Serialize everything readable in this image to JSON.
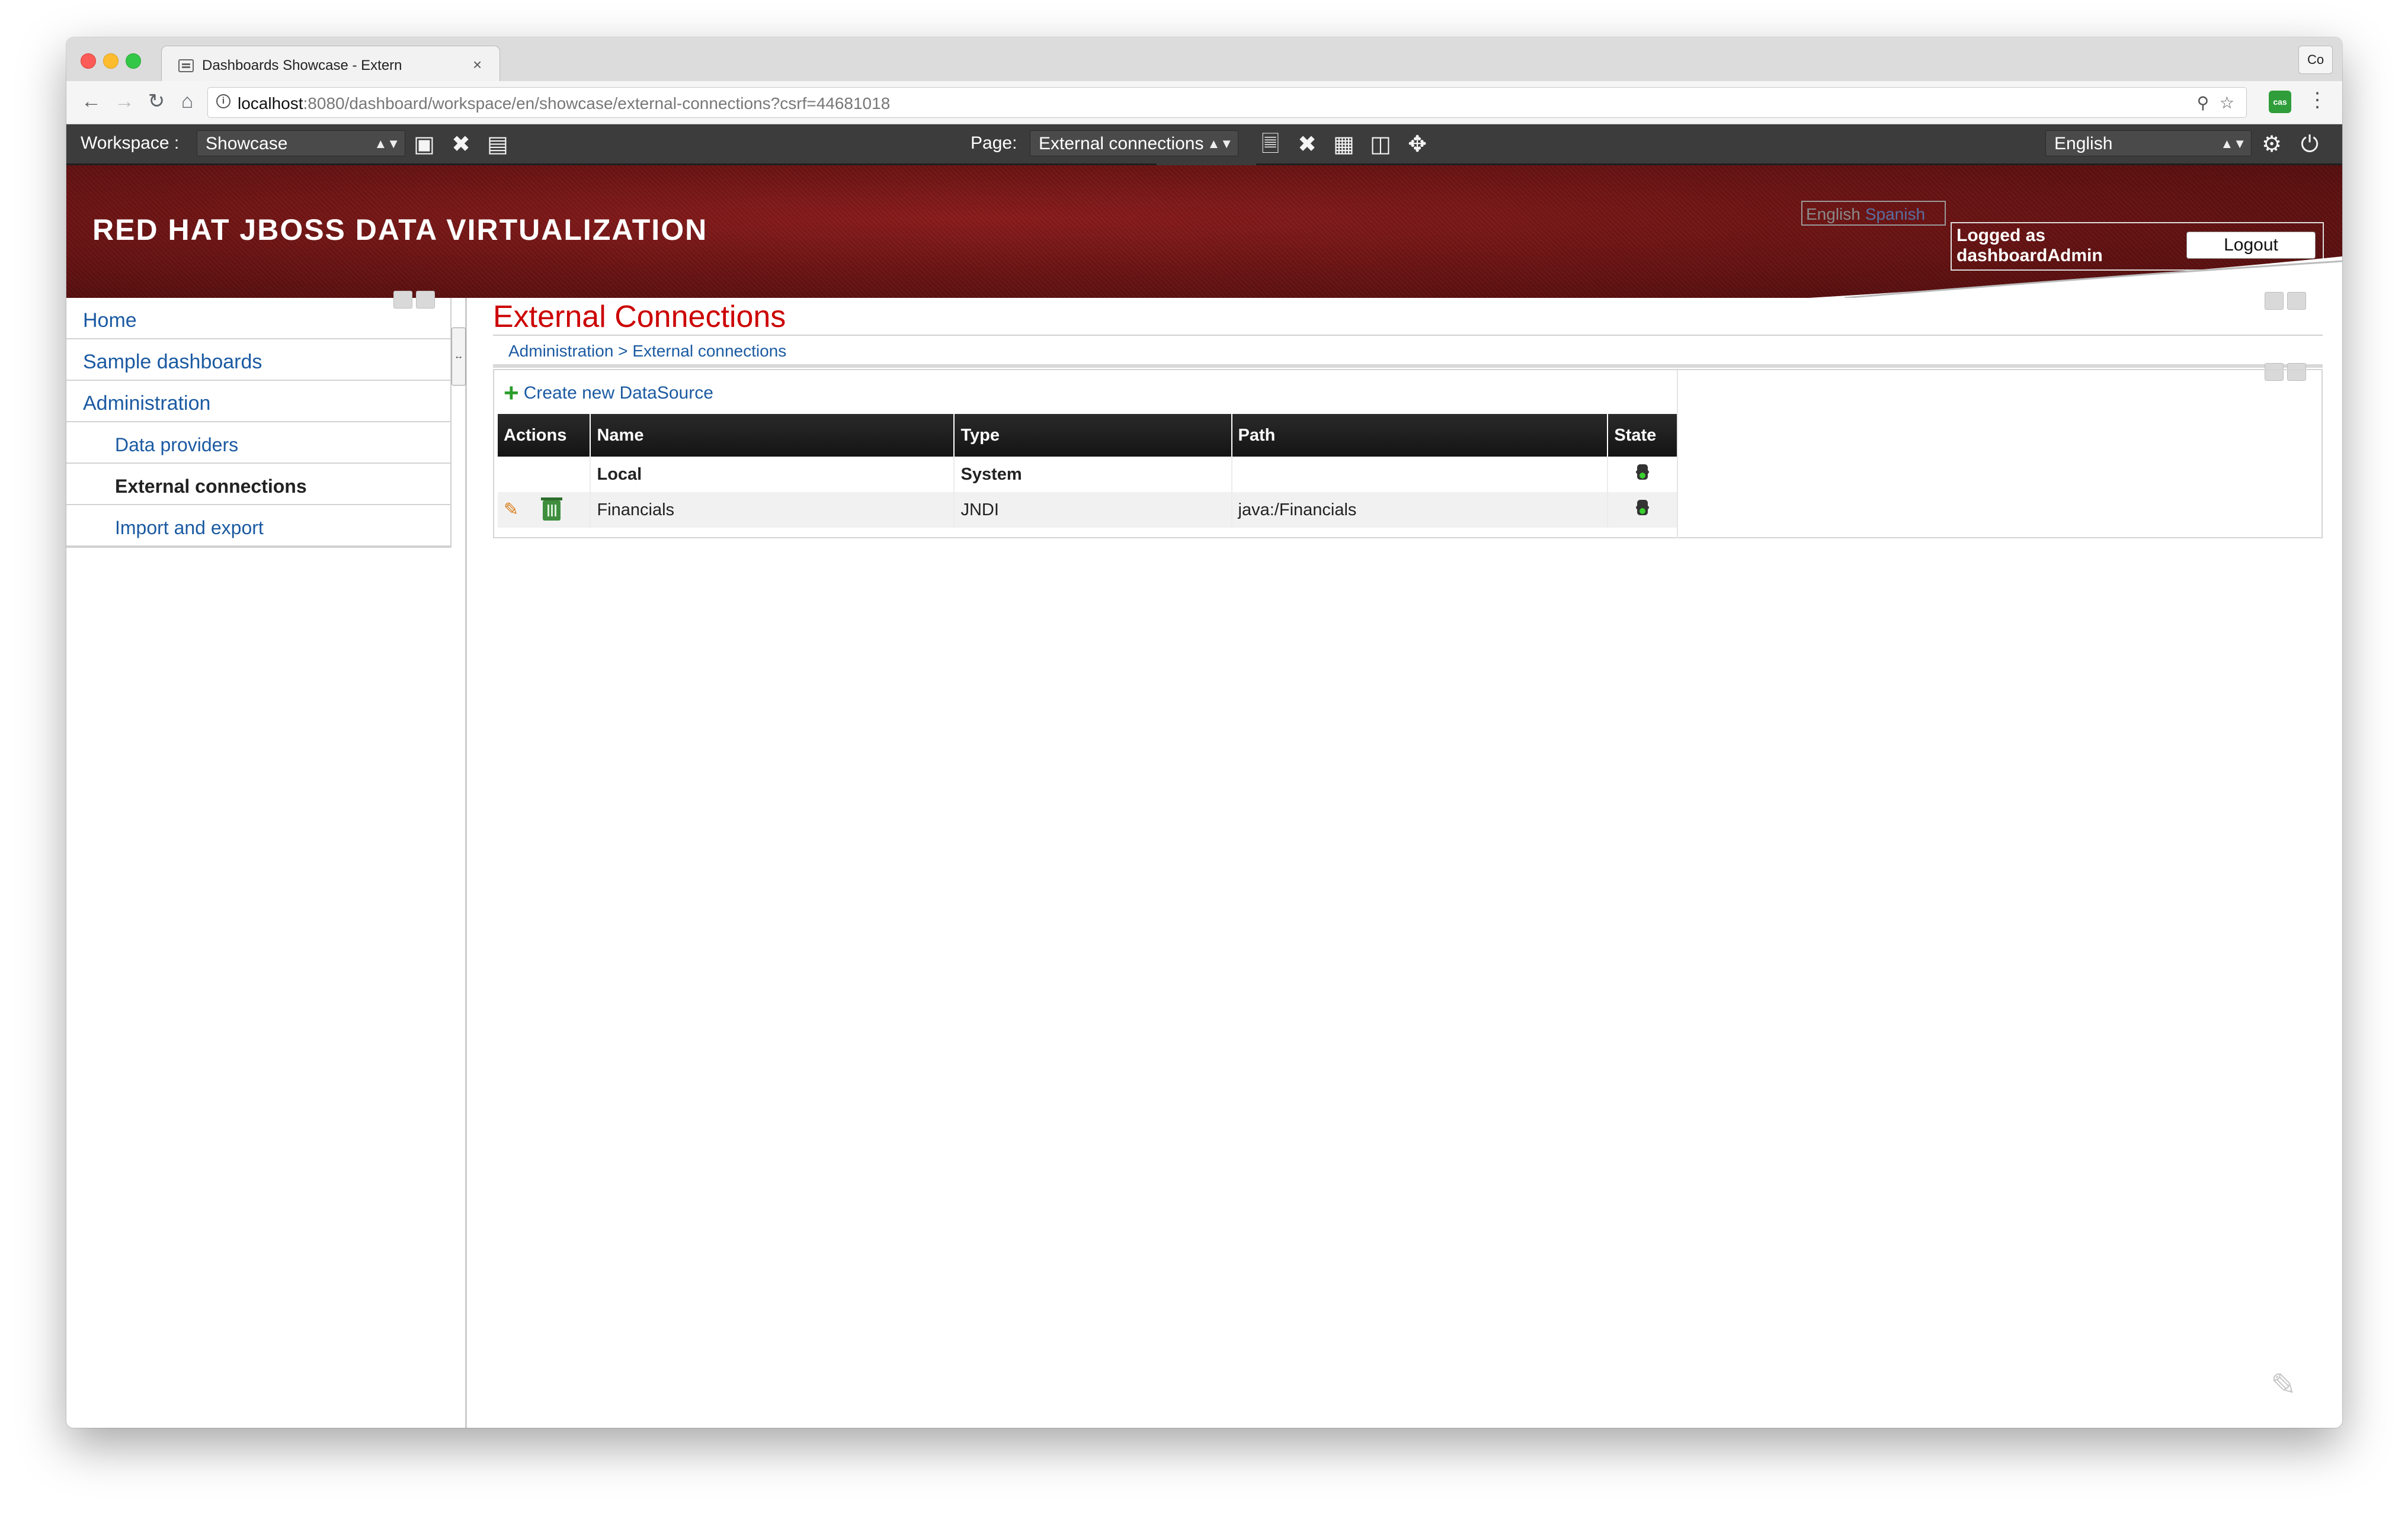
{
  "browser": {
    "tab_title": "Dashboards Showcase - Extern",
    "tab_close": "×",
    "profile_label": "Co",
    "url_host": "localhost",
    "url_rest": ":8080/dashboard/workspace/en/showcase/external-connections?csrf=44681018",
    "extension_label": "cas"
  },
  "workspace_bar": {
    "workspace_label": "Workspace :",
    "workspace_value": "Showcase",
    "page_label": "Page:",
    "page_value": "External connections",
    "language_value": "English"
  },
  "header": {
    "logo_text": "RED HAT JBOSS DATA VIRTUALIZATION",
    "lang_english": "English",
    "lang_spanish": "Spanish",
    "logged_as_line1": "Logged as",
    "logged_as_line2": "dashboardAdmin",
    "logout_label": "Logout"
  },
  "sidebar": {
    "items": [
      {
        "label": "Home",
        "level": 1,
        "active": false
      },
      {
        "label": "Sample dashboards",
        "level": 1,
        "active": false
      },
      {
        "label": "Administration",
        "level": 1,
        "active": false
      },
      {
        "label": "Data providers",
        "level": 2,
        "active": false
      },
      {
        "label": "External connections",
        "level": 2,
        "active": true
      },
      {
        "label": "Import and export",
        "level": 2,
        "active": false
      }
    ]
  },
  "main": {
    "title": "External Connections",
    "breadcrumb": "Administration > External connections",
    "create_link": "Create new DataSource",
    "table": {
      "headers": [
        "Actions",
        "Name",
        "Type",
        "Path",
        "State"
      ],
      "rows": [
        {
          "name": "Local",
          "type": "System",
          "path": "",
          "state": "active"
        },
        {
          "name": "Financials",
          "type": "JNDI",
          "path": "java:/Financials",
          "state": "active"
        }
      ]
    }
  },
  "colors": {
    "accent_red": "#cc0000",
    "link_blue": "#1b5aa2",
    "toolbar_dark": "#3c3c3c",
    "banner_red": "#6d1414"
  }
}
